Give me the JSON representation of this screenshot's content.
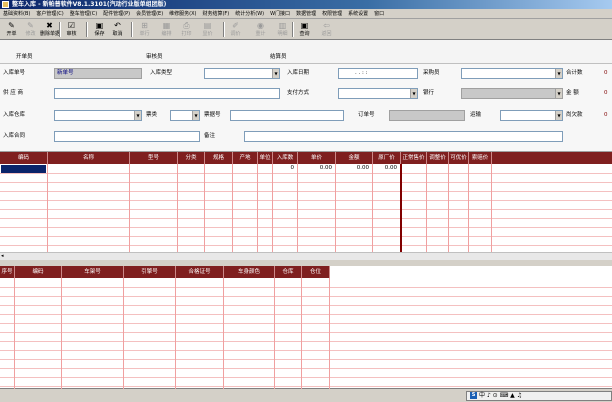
{
  "window": {
    "title": "整车入库 - 新帕普软件V8.1.3101(汽动行业版单组团版)"
  },
  "menu": [
    "基础资料(B)",
    "客户管理(C)",
    "整车管理(C)",
    "配件管理(P)",
    "会员管理(E)",
    "维修服务(X)",
    "财务结算(F)",
    "统计分析(W)",
    "W门接口",
    "数据管理",
    "权限管理",
    "系统设置",
    "窗口"
  ],
  "toolbar": [
    {
      "label": "开单",
      "icon": "new-doc-icon",
      "glyph": "✎",
      "enabled": true
    },
    {
      "label": "修改",
      "icon": "edit-icon",
      "glyph": "✎",
      "enabled": false
    },
    {
      "label": "删除单据",
      "icon": "delete-icon",
      "glyph": "✖",
      "enabled": true
    },
    {
      "label": "审核",
      "icon": "approve-icon",
      "glyph": "☑",
      "enabled": true
    },
    {
      "label": "保存",
      "icon": "save-icon",
      "glyph": "▣",
      "enabled": true
    },
    {
      "label": "取消",
      "icon": "cancel-icon",
      "glyph": "↶",
      "enabled": true
    },
    {
      "label": "单行",
      "icon": "single-row-icon",
      "glyph": "⊞",
      "enabled": false
    },
    {
      "label": "编排",
      "icon": "arrange-icon",
      "glyph": "▦",
      "enabled": false
    },
    {
      "label": "打印",
      "icon": "print-icon",
      "glyph": "⎙",
      "enabled": false
    },
    {
      "label": "显价",
      "icon": "price-icon",
      "glyph": "▤",
      "enabled": false
    },
    {
      "label": "调价",
      "icon": "adjust-icon",
      "glyph": "✐",
      "enabled": false
    },
    {
      "label": "重计",
      "icon": "recalc-icon",
      "glyph": "◉",
      "enabled": false
    },
    {
      "label": "明细",
      "icon": "detail-icon",
      "glyph": "▥",
      "enabled": false
    },
    {
      "label": "查询",
      "icon": "query-icon",
      "glyph": "▣",
      "enabled": true
    },
    {
      "label": "返回",
      "icon": "back-icon",
      "glyph": "⇦",
      "enabled": false
    }
  ],
  "signatures": {
    "creator": "开单员",
    "auditor": "审核员",
    "settler": "结算员"
  },
  "form": {
    "receipt_no_label": "入库单号",
    "receipt_no_value": "新单号",
    "type_label": "入库类型",
    "date_label": "入库日期",
    "date_value": ".  .  :  :",
    "buyer_label": "采购员",
    "total_qty_label": "合计数",
    "total_qty_value": "0",
    "supplier_label": "供 应 商",
    "pay_method_label": "支付方式",
    "bank_label": "银行",
    "amount_label": "金  额",
    "amount_value": "0",
    "warehouse_label": "入库仓库",
    "invoice_label": "票类",
    "invoice_no_label": "票据号",
    "order_no_label": "订单号",
    "transport_label": "运输",
    "debt_label": "尚欠款",
    "debt_value": "0",
    "contract_label": "入库合同",
    "remark_label": "备注"
  },
  "grid1": {
    "headers": [
      "编码",
      "名称",
      "型号",
      "分类",
      "规格",
      "产地",
      "单位",
      "入库数",
      "单价",
      "金额",
      "原厂价",
      "正常售价",
      "调整价",
      "可优价",
      "索赔价"
    ],
    "row": {
      "qty": "0",
      "price": "0.00",
      "amount": "0.00",
      "factory": "0.00"
    }
  },
  "grid2": {
    "headers": [
      "序号",
      "编码",
      "车架号",
      "引擎号",
      "合格证号",
      "车身颜色",
      "仓库",
      "仓位"
    ]
  },
  "ime": {
    "label": "中",
    "tail": "♪ ⊙ ⌨ ▲ ♫"
  }
}
